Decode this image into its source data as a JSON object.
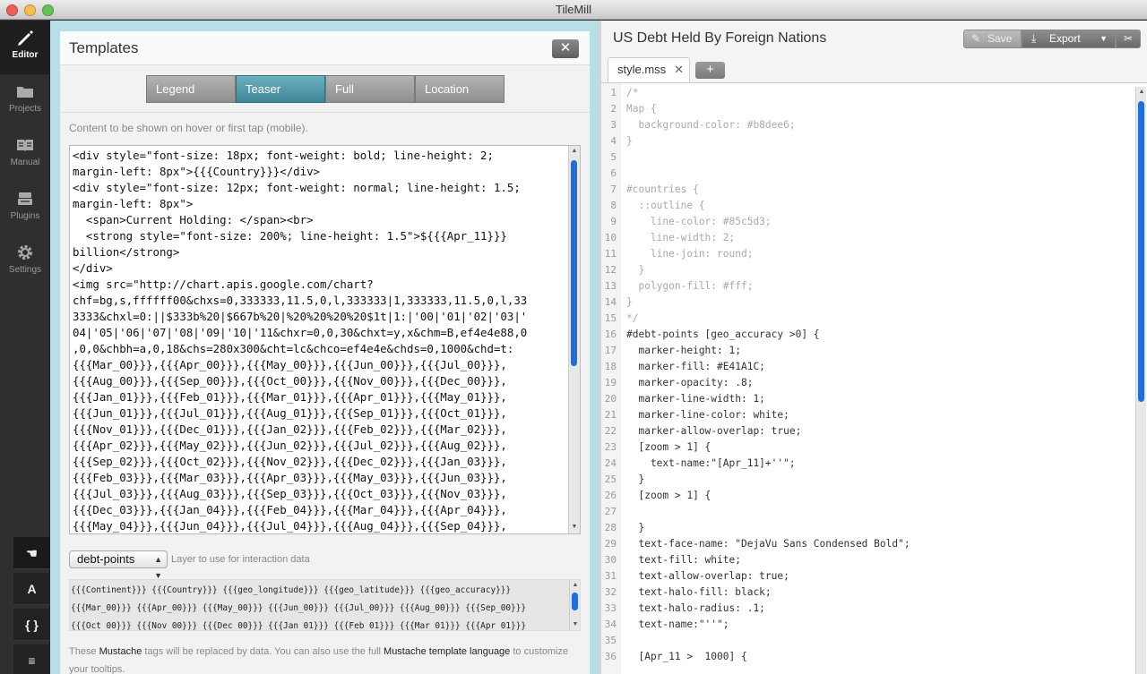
{
  "window": {
    "title": "TileMill"
  },
  "sidebar": {
    "items": [
      {
        "label": "Editor",
        "icon": "pencil-icon"
      },
      {
        "label": "Projects",
        "icon": "folder-icon"
      },
      {
        "label": "Manual",
        "icon": "book-icon"
      },
      {
        "label": "Plugins",
        "icon": "plugin-icon"
      },
      {
        "label": "Settings",
        "icon": "gear-icon"
      }
    ],
    "tools": [
      "☚",
      "A",
      "{ }",
      "≡"
    ]
  },
  "templates": {
    "title": "Templates",
    "close_label": "✕",
    "tabs": [
      "Legend",
      "Teaser",
      "Full",
      "Location"
    ],
    "active_tab": "Teaser",
    "description": "Content to be shown on hover or first tap (mobile).",
    "content_lines": [
      "<div style=\"font-size: 18px; font-weight: bold; line-height: 2;",
      "margin-left: 8px\">{{{Country}}}</div>",
      "<div style=\"font-size: 12px; font-weight: normal; line-height: 1.5;",
      "margin-left: 8px\">",
      "  <span>Current Holding: </span><br>",
      "  <strong style=\"font-size: 200%; line-height: 1.5\">${{{Apr_11}}}",
      "billion</strong>",
      "</div>",
      "<img src=\"http://chart.apis.google.com/chart?",
      "chf=bg,s,ffffff00&chxs=0,333333,11.5,0,l,333333|1,333333,11.5,0,l,33",
      "3333&chxl=0:||$333b%20|$667b%20|%20%20%20%20$1t|1:|'00|'01|'02|'03|'",
      "04|'05|'06|'07|'08|'09|'10|'11&chxr=0,0,30&chxt=y,x&chm=B,ef4e4e88,0",
      ",0,0&chbh=a,0,18&chs=280x300&cht=lc&chco=ef4e4e&chds=0,1000&chd=t:",
      "{{{Mar_00}}},{{{Apr_00}}},{{{May_00}}},{{{Jun_00}}},{{{Jul_00}}},",
      "{{{Aug_00}}},{{{Sep_00}}},{{{Oct_00}}},{{{Nov_00}}},{{{Dec_00}}},",
      "{{{Jan_01}}},{{{Feb_01}}},{{{Mar_01}}},{{{Apr_01}}},{{{May_01}}},",
      "{{{Jun_01}}},{{{Jul_01}}},{{{Aug_01}}},{{{Sep_01}}},{{{Oct_01}}},",
      "{{{Nov_01}}},{{{Dec_01}}},{{{Jan_02}}},{{{Feb_02}}},{{{Mar_02}}},",
      "{{{Apr_02}}},{{{May_02}}},{{{Jun_02}}},{{{Jul_02}}},{{{Aug_02}}},",
      "{{{Sep_02}}},{{{Oct_02}}},{{{Nov_02}}},{{{Dec_02}}},{{{Jan_03}}},",
      "{{{Feb_03}}},{{{Mar_03}}},{{{Apr_03}}},{{{May_03}}},{{{Jun_03}}},",
      "{{{Jul_03}}},{{{Aug_03}}},{{{Sep_03}}},{{{Oct_03}}},{{{Nov_03}}},",
      "{{{Dec_03}}},{{{Jan_04}}},{{{Feb_04}}},{{{Mar_04}}},{{{Apr_04}}},",
      "{{{May_04}}},{{{Jun_04}}},{{{Jul_04}}},{{{Aug_04}}},{{{Sep_04}}},"
    ],
    "layer_select": "debt-points",
    "layer_hint": "Layer to use for interaction data",
    "tag_lines": [
      "{{{Continent}}} {{{Country}}} {{{geo_longitude}}} {{{geo_latitude}}} {{{geo_accuracy}}}",
      "{{{Mar_00}}} {{{Apr_00}}} {{{May_00}}} {{{Jun_00}}} {{{Jul_00}}} {{{Aug_00}}} {{{Sep_00}}}",
      "{{{Oct_00}}} {{{Nov_00}}} {{{Dec_00}}} {{{Jan_01}}} {{{Feb_01}}} {{{Mar_01}}} {{{Apr_01}}}"
    ],
    "footnote": {
      "t1": "These ",
      "mustache": "Mustache",
      "t2": " tags will be replaced by data. You can also use the full ",
      "link": "Mustache template language",
      "t3": " to customize your tooltips."
    }
  },
  "project": {
    "title": "US Debt Held By Foreign Nations",
    "save_label": "Save",
    "export_label": "Export",
    "file_tab": "style.mss",
    "add_tab": "+"
  },
  "code_lines": [
    {
      "n": "1",
      "t": "/*"
    },
    {
      "n": "2",
      "t": "Map {"
    },
    {
      "n": "3",
      "t": "  background-color: #b8dee6;"
    },
    {
      "n": "4",
      "t": "}"
    },
    {
      "n": "5",
      "t": ""
    },
    {
      "n": "6",
      "t": ""
    },
    {
      "n": "7",
      "t": "#countries {"
    },
    {
      "n": "8",
      "t": "  ::outline {"
    },
    {
      "n": "9",
      "t": "    line-color: #85c5d3;"
    },
    {
      "n": "10",
      "t": "    line-width: 2;"
    },
    {
      "n": "11",
      "t": "    line-join: round;"
    },
    {
      "n": "12",
      "t": "  }"
    },
    {
      "n": "13",
      "t": "  polygon-fill: #fff;"
    },
    {
      "n": "14",
      "t": "}"
    },
    {
      "n": "15",
      "t": "*/"
    },
    {
      "n": "16",
      "t": "#debt-points [geo_accuracy >0] {"
    },
    {
      "n": "17",
      "t": "  marker-height: 1;"
    },
    {
      "n": "18",
      "t": "  marker-fill: #E41A1C;"
    },
    {
      "n": "19",
      "t": "  marker-opacity: .8;"
    },
    {
      "n": "20",
      "t": "  marker-line-width: 1;"
    },
    {
      "n": "21",
      "t": "  marker-line-color: white;"
    },
    {
      "n": "22",
      "t": "  marker-allow-overlap: true;"
    },
    {
      "n": "23",
      "t": "  [zoom > 1] {"
    },
    {
      "n": "24",
      "t": "    text-name:\"[Apr_11]+''\";"
    },
    {
      "n": "25",
      "t": "  }"
    },
    {
      "n": "26",
      "t": "  [zoom > 1] {"
    },
    {
      "n": "27",
      "t": ""
    },
    {
      "n": "28",
      "t": "  }"
    },
    {
      "n": "29",
      "t": "  text-face-name: \"DejaVu Sans Condensed Bold\";"
    },
    {
      "n": "30",
      "t": "  text-fill: white;"
    },
    {
      "n": "31",
      "t": "  text-allow-overlap: true;"
    },
    {
      "n": "32",
      "t": "  text-halo-fill: black;"
    },
    {
      "n": "33",
      "t": "  text-halo-radius: .1;"
    },
    {
      "n": "34",
      "t": "  text-name:\"''\";"
    },
    {
      "n": "35",
      "t": ""
    },
    {
      "n": "36",
      "t": "  [Apr_11 >  1000] {"
    }
  ],
  "colors": {
    "map_bg": "#b8dee6",
    "accent": "#4a95a8",
    "error": "#e21"
  }
}
